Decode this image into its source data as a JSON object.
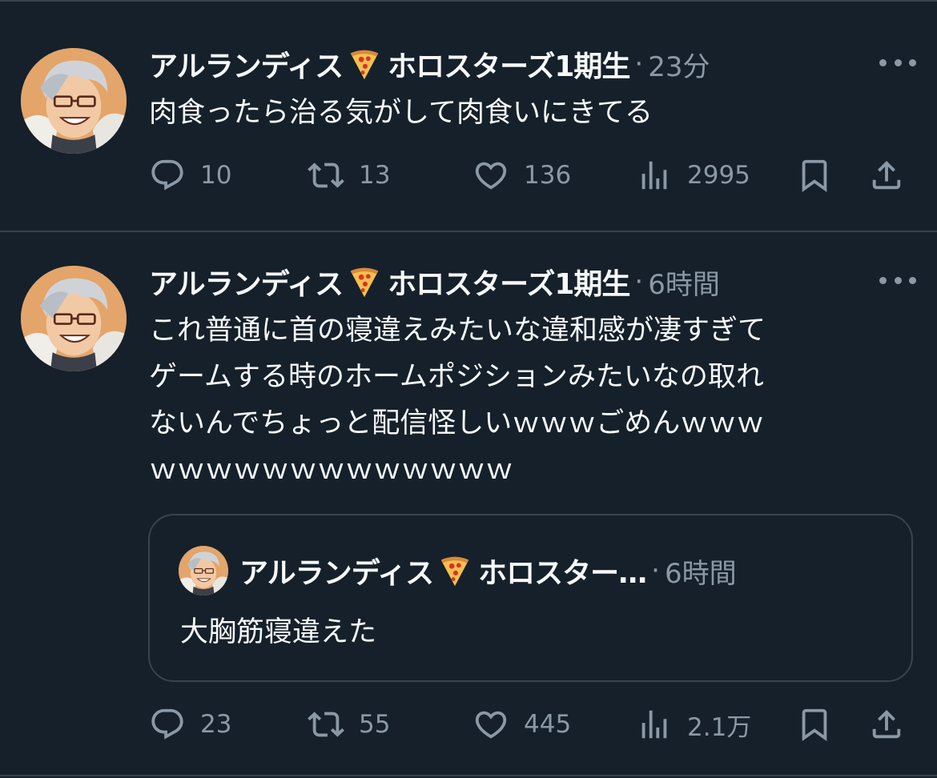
{
  "tweets": [
    {
      "author": "アルランディス",
      "author_suffix": "ホロスターズ1期生",
      "separator": "·",
      "time": "23分",
      "text": "肉食ったら治る気がして肉食いにきてる",
      "replies": "10",
      "retweets": "13",
      "likes": "136",
      "views": "2995"
    },
    {
      "author": "アルランディス",
      "author_suffix": "ホロスターズ1期生",
      "separator": "·",
      "time": "6時間",
      "text_lines": [
        "これ普通に首の寝違えみたいな違和感が凄すぎて",
        "ゲームする時のホームポジションみたいなの取れ",
        "ないんでちょっと配信怪しいｗｗｗごめんｗｗｗ",
        "ｗｗｗｗｗｗｗｗｗｗｗｗｗ"
      ],
      "quote": {
        "author": "アルランディス",
        "author_suffix": "ホロスター…",
        "separator": "·",
        "time": "6時間",
        "text": "大胸筋寝違えた"
      },
      "replies": "23",
      "retweets": "55",
      "likes": "445",
      "views": "2.1万"
    }
  ],
  "icons": {
    "reply": "reply-icon",
    "retweet": "retweet-icon",
    "like": "heart-icon",
    "views": "views-icon",
    "bookmark": "bookmark-icon",
    "share": "share-icon",
    "more": "more-icon",
    "emoji": "pizza-emoji"
  },
  "colors": {
    "background": "#15202b",
    "text_primary": "#f7f9f9",
    "text_secondary": "#8b98a5",
    "border": "#38444d"
  }
}
